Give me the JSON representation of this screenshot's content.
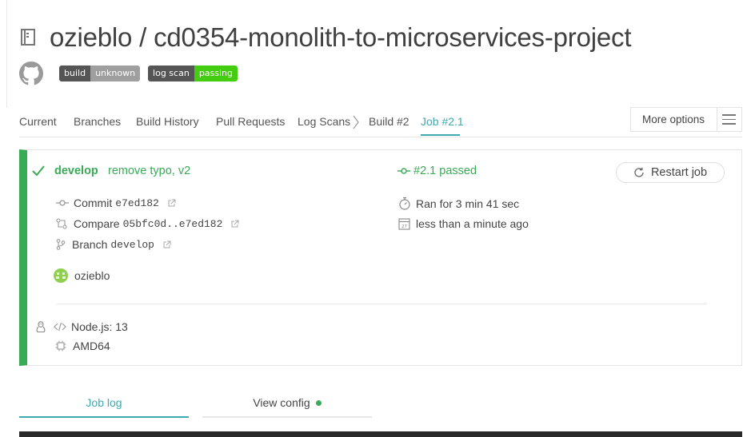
{
  "repo": {
    "title": "ozieblo / cd0354-monolith-to-microservices-project",
    "badges": [
      {
        "key": "build",
        "value": "unknown"
      },
      {
        "key": "log scan",
        "value": "passing"
      }
    ]
  },
  "nav": {
    "tabs": [
      "Current",
      "Branches",
      "Build History",
      "Pull Requests",
      "Log Scans",
      "Build #2",
      "Job #2.1"
    ],
    "active_tab": "Job #2.1",
    "more_options": "More options"
  },
  "job": {
    "branch": "develop",
    "commit_message": "remove typo, v2",
    "status": "#2.1 passed",
    "restart_label": "Restart job",
    "commit_label": "Commit",
    "commit_sha": "e7ed182",
    "compare_label": "Compare",
    "compare_range": "05bfc0d..e7ed182",
    "branch_label": "Branch",
    "branch_value": "develop",
    "duration": "Ran for 3 min 41 sec",
    "finished": "less than a minute ago",
    "author": "ozieblo",
    "language": "Node.js: 13",
    "arch": "AMD64"
  },
  "bottom_tabs": {
    "job_log": "Job log",
    "view_config": "View config"
  },
  "colors": {
    "passed": "#39aa56",
    "active_tab": "#3eaaaf",
    "badge_unknown": "#9f9f9f",
    "badge_passing": "#44cc11"
  },
  "icons": [
    "repo-icon",
    "github-icon",
    "chevron-right-icon",
    "hamburger-icon",
    "check-icon",
    "commit-icon",
    "compare-icon",
    "branch-icon",
    "external-link-icon",
    "stopwatch-icon",
    "calendar-icon",
    "restart-icon",
    "avatar",
    "linux-icon",
    "code-icon",
    "cpu-icon"
  ]
}
